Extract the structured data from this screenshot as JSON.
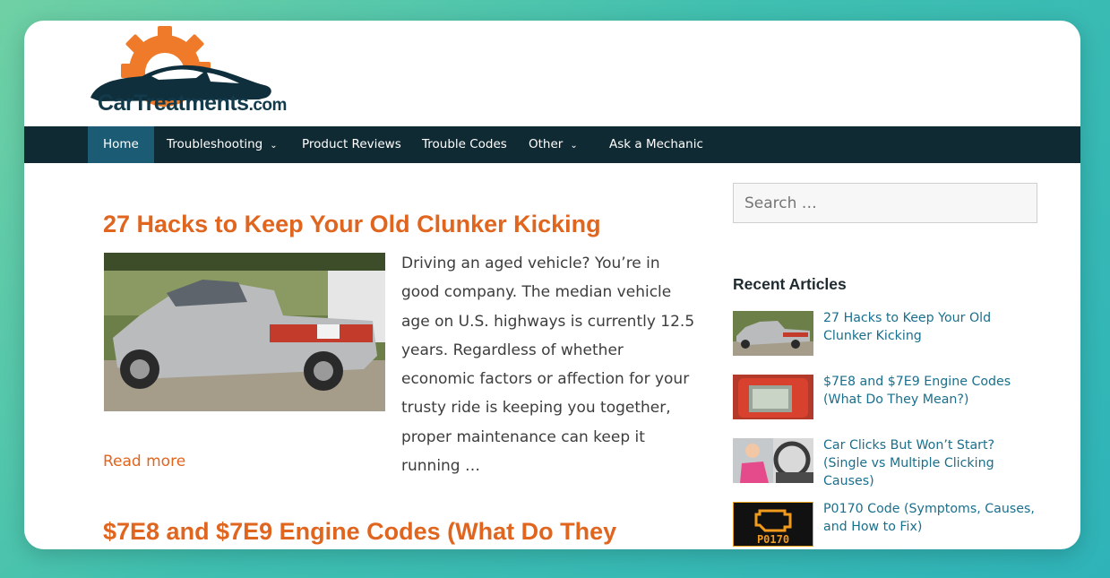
{
  "site": {
    "logo_text": "CarTreatments",
    "logo_suffix": ".com"
  },
  "nav": {
    "items": [
      {
        "label": "Home"
      },
      {
        "label": "Troubleshooting",
        "caret": "⌄"
      },
      {
        "label": "Product Reviews"
      },
      {
        "label": "Trouble Codes"
      },
      {
        "label": "Other",
        "caret": "⌄"
      },
      {
        "label": "Ask a Mechanic"
      }
    ]
  },
  "posts": [
    {
      "title": "27 Hacks to Keep Your Old Clunker Kicking",
      "excerpt": "Driving an aged vehicle? You’re in good company. The median vehicle age on U.S. highways is currently 12.5 years. Regardless of whether economic factors or affection for your trusty ride is keeping you together, proper maintenance can keep it running …",
      "read_more": "Read more"
    },
    {
      "title": "$7E8 and $7E9 Engine Codes (What Do They"
    }
  ],
  "sidebar": {
    "search_placeholder": "Search …",
    "recent_title": "Recent Articles",
    "recent": [
      {
        "title": "27 Hacks to Keep Your Old Clunker Kicking"
      },
      {
        "title": "$7E8 and $7E9 Engine Codes (What Do They Mean?)"
      },
      {
        "title": "Car Clicks But Won’t Start? (Single vs Multiple Clicking Causes)"
      },
      {
        "title": "P0170 Code (Symptoms, Causes, and How to Fix)",
        "thumb_text": "P0170"
      }
    ]
  },
  "colors": {
    "accent": "#e0651f",
    "nav_bg": "#102a33",
    "nav_active": "#1b5b73",
    "link": "#1a6f8c"
  }
}
